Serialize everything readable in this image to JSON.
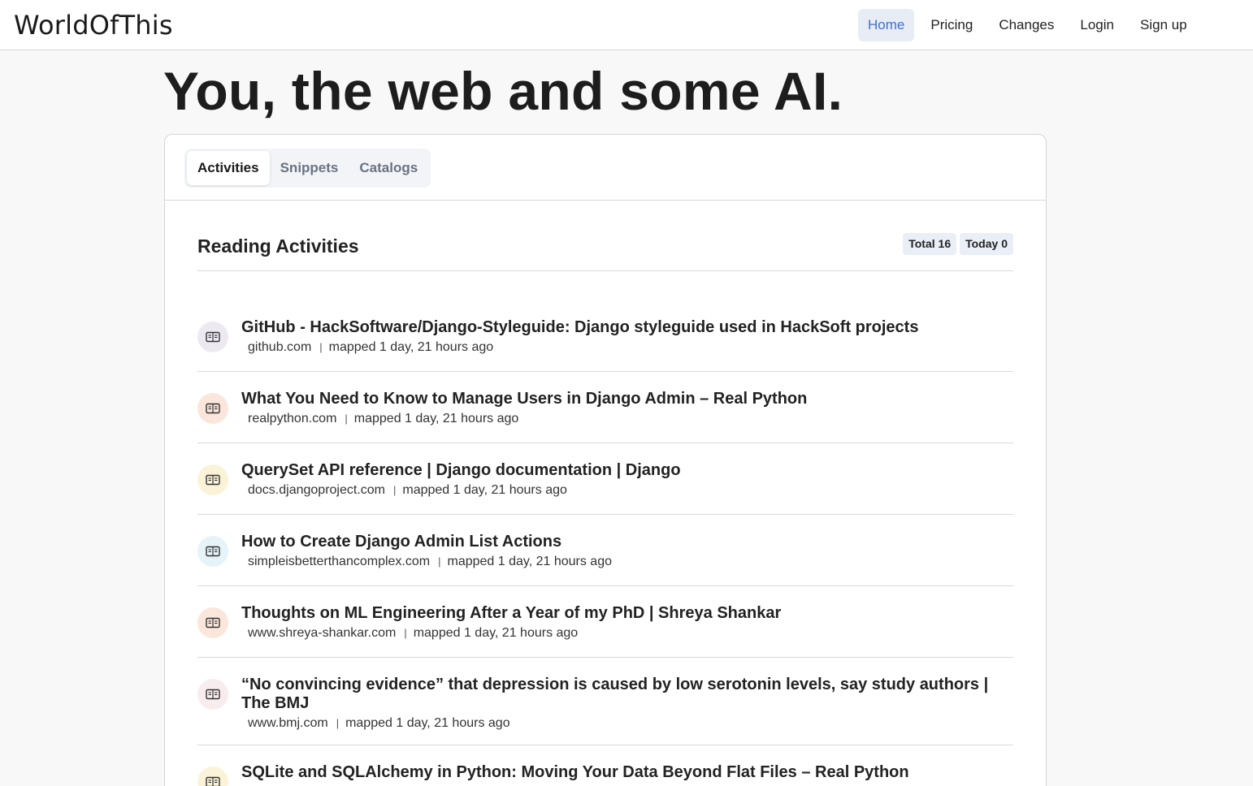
{
  "brand": "WorldOfThis",
  "nav": [
    {
      "label": "Home",
      "active": true
    },
    {
      "label": "Pricing",
      "active": false
    },
    {
      "label": "Changes",
      "active": false
    },
    {
      "label": "Login",
      "active": false
    },
    {
      "label": "Sign up",
      "active": false
    }
  ],
  "hero": "You, the web and some AI.",
  "tabs": [
    {
      "label": "Activities",
      "active": true
    },
    {
      "label": "Snippets",
      "active": false
    },
    {
      "label": "Catalogs",
      "active": false
    }
  ],
  "section": {
    "title": "Reading Activities",
    "total_label": "Total",
    "total_value": "16",
    "today_label": "Today",
    "today_value": "0"
  },
  "colors": {
    "icon_bg": [
      "#ede9f1",
      "#fbe6dc",
      "#fbf3d7",
      "#e6f3f9",
      "#fbe6dc",
      "#f9ecee",
      "#fbf3d7"
    ]
  },
  "icon_name": "book-open-icon",
  "activities": [
    {
      "title": "GitHub - HackSoftware/Django-Styleguide: Django styleguide used in HackSoft projects",
      "domain": "github.com",
      "mapped": "mapped 1 day, 21 hours ago"
    },
    {
      "title": "What You Need to Know to Manage Users in Django Admin – Real Python",
      "domain": "realpython.com",
      "mapped": "mapped 1 day, 21 hours ago"
    },
    {
      "title": "QuerySet API reference | Django documentation | Django",
      "domain": "docs.djangoproject.com",
      "mapped": "mapped 1 day, 21 hours ago"
    },
    {
      "title": "How to Create Django Admin List Actions",
      "domain": "simpleisbetterthancomplex.com",
      "mapped": "mapped 1 day, 21 hours ago"
    },
    {
      "title": "Thoughts on ML Engineering After a Year of my PhD | Shreya Shankar",
      "domain": "www.shreya-shankar.com",
      "mapped": "mapped 1 day, 21 hours ago"
    },
    {
      "title": "“No convincing evidence” that depression is caused by low serotonin levels, say study authors | The BMJ",
      "domain": "www.bmj.com",
      "mapped": "mapped 1 day, 21 hours ago"
    },
    {
      "title": "SQLite and SQLAlchemy in Python: Moving Your Data Beyond Flat Files – Real Python",
      "domain": "",
      "mapped": ""
    }
  ]
}
